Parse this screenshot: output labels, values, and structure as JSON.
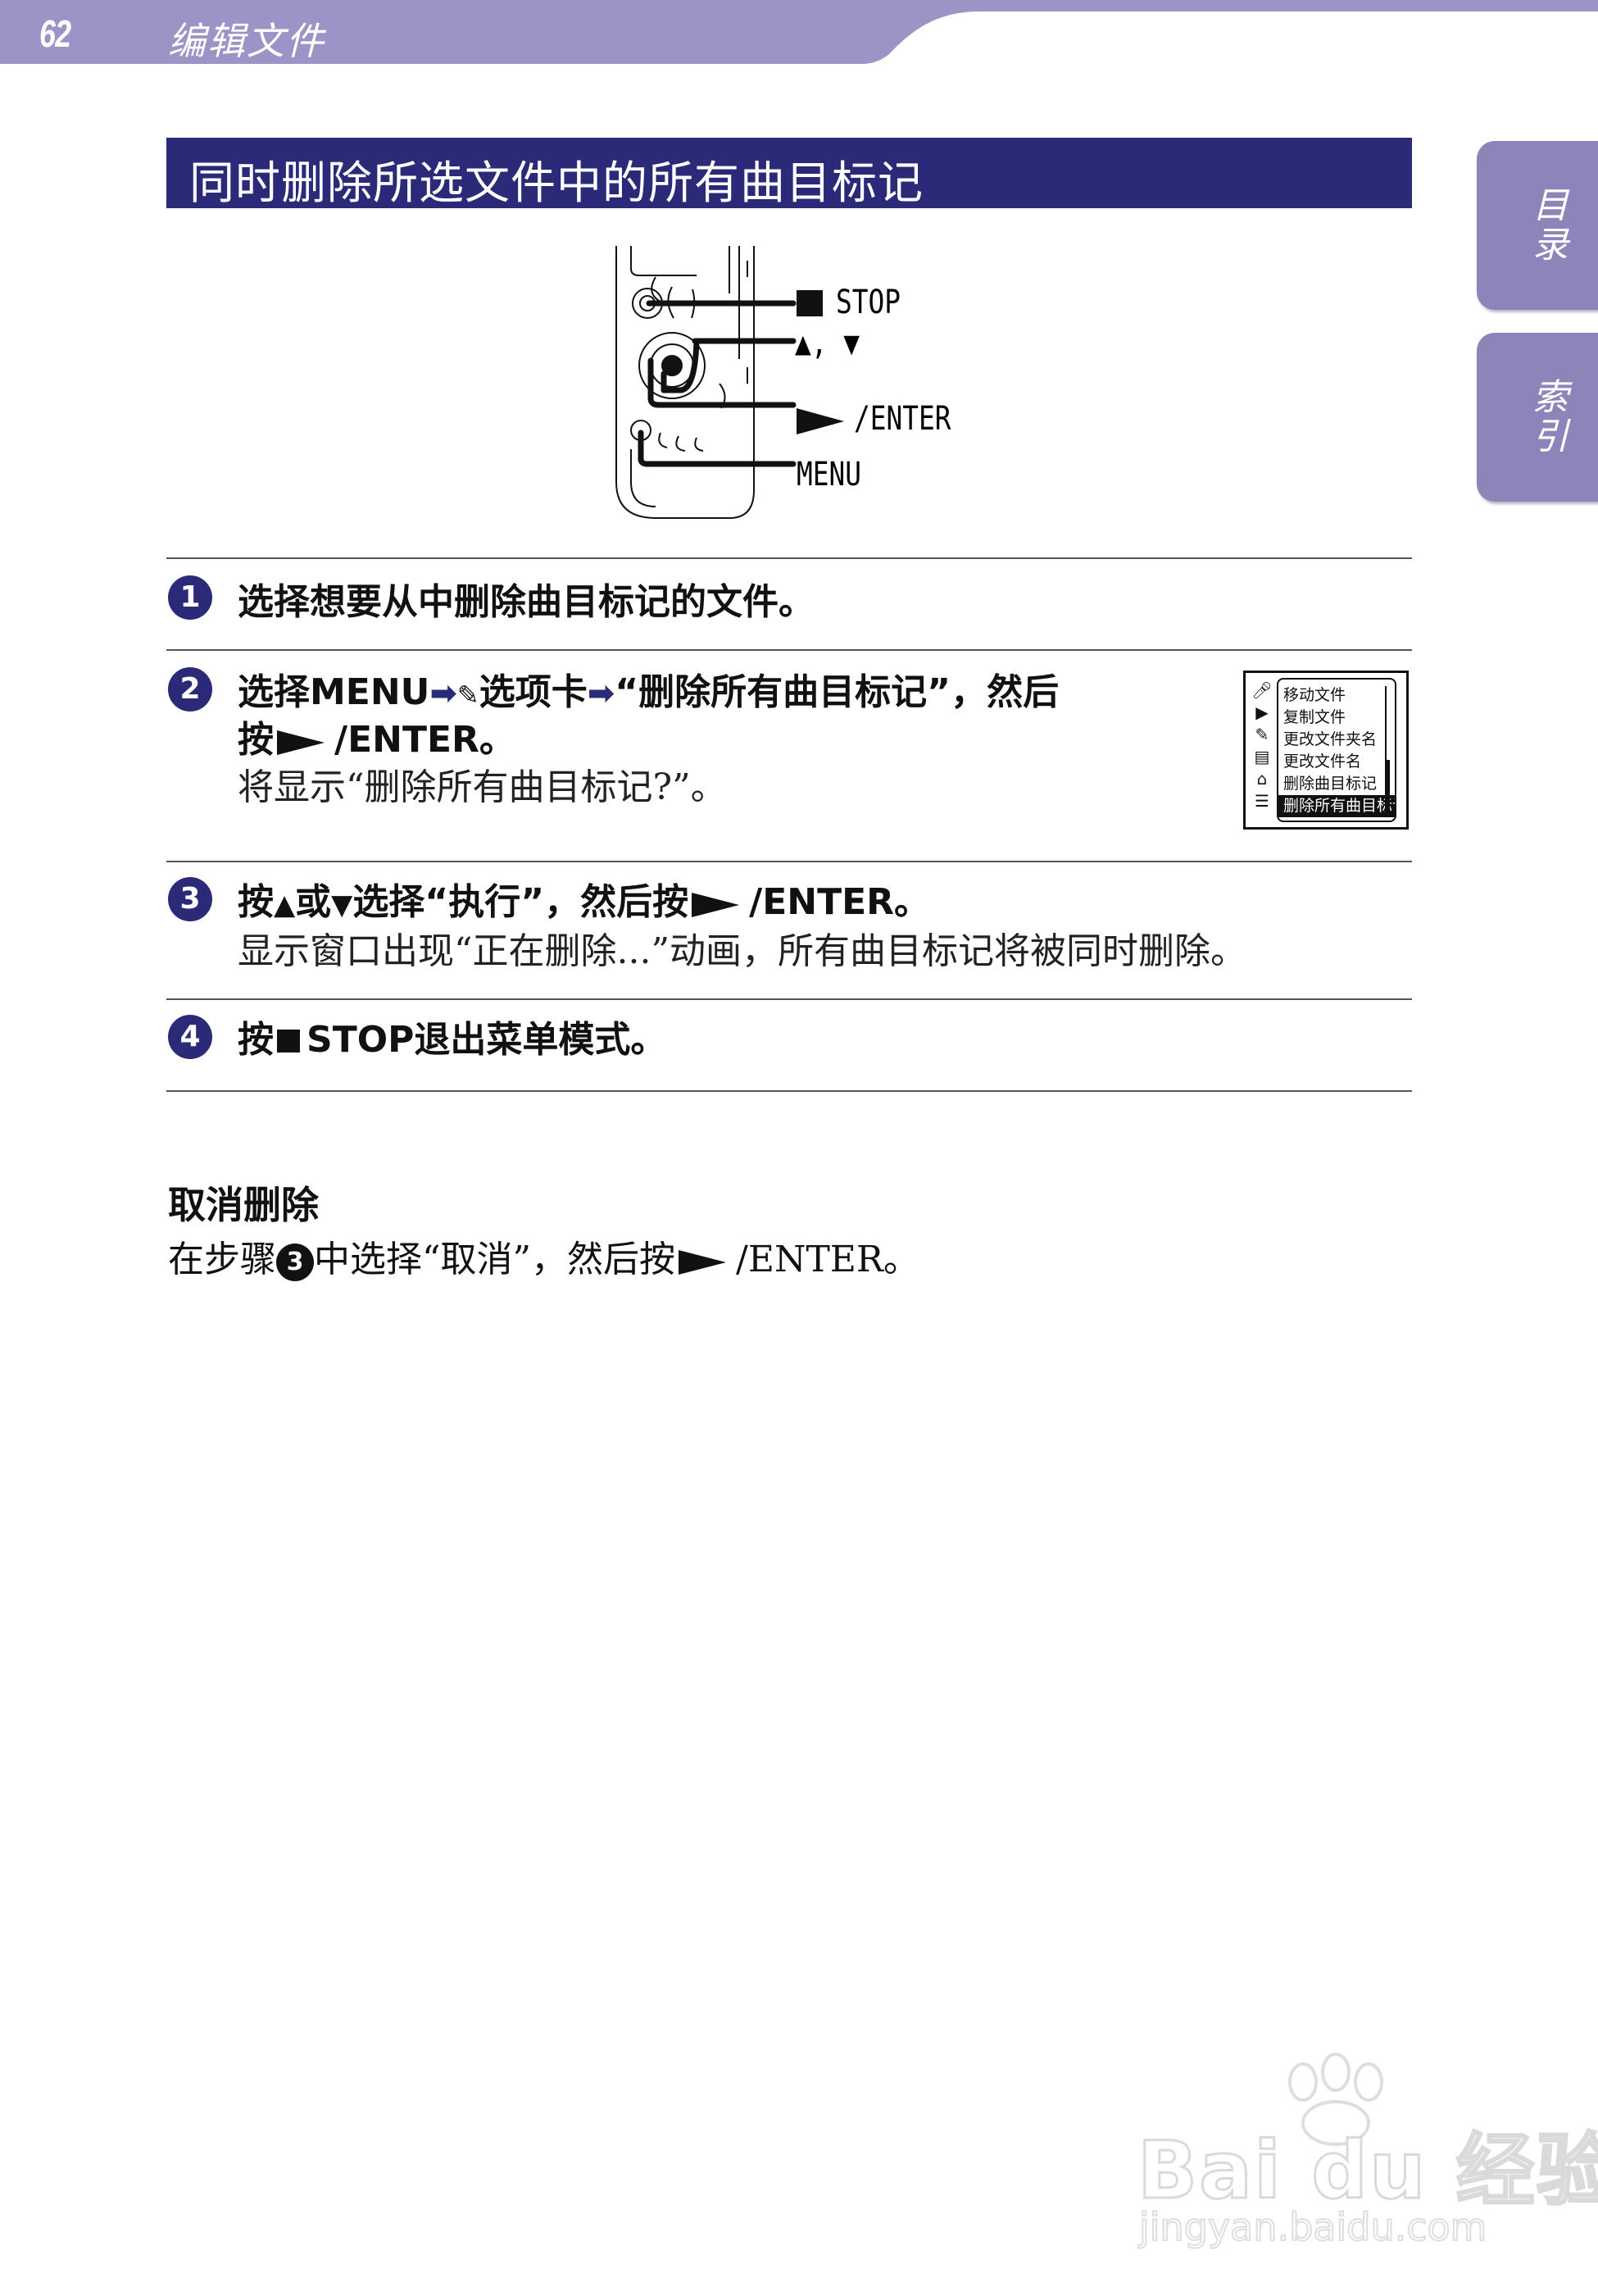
{
  "header": {
    "page_number": "62",
    "section": "编辑文件"
  },
  "side_tabs": [
    {
      "label": "目录"
    },
    {
      "label": "索引"
    }
  ],
  "title": "同时删除所选文件中的所有曲目标记",
  "device": {
    "labels": {
      "stop": "STOP",
      "updown": "▲, ▼",
      "enter": "/ENTER",
      "menu": "MENU"
    }
  },
  "steps": [
    {
      "num": "1",
      "text": "选择想要从中删除曲目标记的文件。"
    },
    {
      "num": "2",
      "line1_a": "选择MENU",
      "line1_b": "选项卡",
      "line1_c": "“删除所有曲目标记”，然后",
      "line2_a": "按",
      "line2_b": "/ENTER。",
      "line3": "将显示“删除所有曲目标记?”。"
    },
    {
      "num": "3",
      "line1_a": "按",
      "line1_b": "或",
      "line1_c": "选择“执行”，然后按",
      "line1_d": "/ENTER。",
      "line2": "显示窗口出现“正在删除...”动画，所有曲目标记将被同时删除。"
    },
    {
      "num": "4",
      "text_a": "按",
      "text_b": "STOP退出菜单模式。"
    }
  ],
  "menu_screenshot": {
    "items": [
      "移动文件",
      "复制文件",
      "更改文件夹名",
      "更改文件名",
      "删除曲目标记",
      "删除所有曲目标记"
    ],
    "selected_index": 5,
    "icons": [
      "mic-icon",
      "play-icon",
      "edit-icon",
      "display-icon",
      "toolbox-icon",
      "radio-icon"
    ]
  },
  "cancel": {
    "heading": "取消删除",
    "text_a": "在步骤",
    "step_ref": "3",
    "text_b": "中选择“取消”，然后按",
    "text_c": "/ENTER。"
  },
  "watermark": {
    "brand": "Bai du 经验",
    "url": "jingyan.baidu.com"
  },
  "colors": {
    "accent": "#2b2a78",
    "header_band": "#9c94c6",
    "side_tab": "#8f84b9"
  }
}
